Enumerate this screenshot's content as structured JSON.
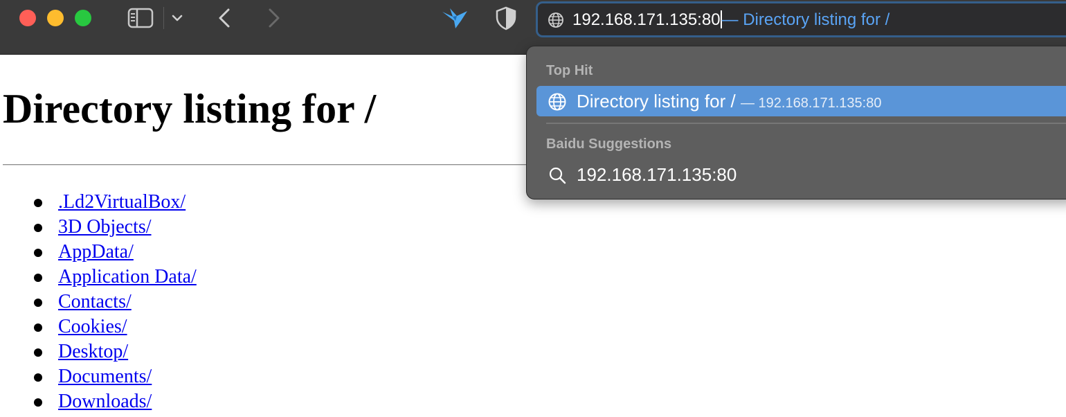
{
  "toolbar": {
    "icons": [
      "close-dot",
      "minimize-dot",
      "maximize-dot",
      "sidebar-icon",
      "chevron-down-icon",
      "back-icon",
      "forward-icon",
      "bird-extension-icon",
      "privacy-shield-icon"
    ],
    "colors": {
      "close": "#ff5f57",
      "minimize": "#febc2e",
      "maximize": "#28c840",
      "extension": "#4aa8f0"
    }
  },
  "address_bar": {
    "typed": "192.168.171.135:80",
    "autocomplete": "— Directory listing for /",
    "icon": "globe-icon",
    "accent": "#5aa4f5"
  },
  "page": {
    "title": "Directory listing for /",
    "items": [
      ".Ld2VirtualBox/",
      "3D Objects/",
      "AppData/",
      "Application Data/",
      "Contacts/",
      "Cookies/",
      "Desktop/",
      "Documents/",
      "Downloads/"
    ],
    "link_color": "#0000ee"
  },
  "dropdown": {
    "top_hit_header": "Top Hit",
    "top_hit": {
      "title": "Directory listing for /",
      "url": "— 192.168.171.135:80",
      "icon": "globe-icon"
    },
    "suggestions_header": "Baidu Suggestions",
    "suggestions": [
      {
        "text": "192.168.171.135:80",
        "icon": "search-icon"
      }
    ],
    "highlight": "#5a95d8"
  }
}
